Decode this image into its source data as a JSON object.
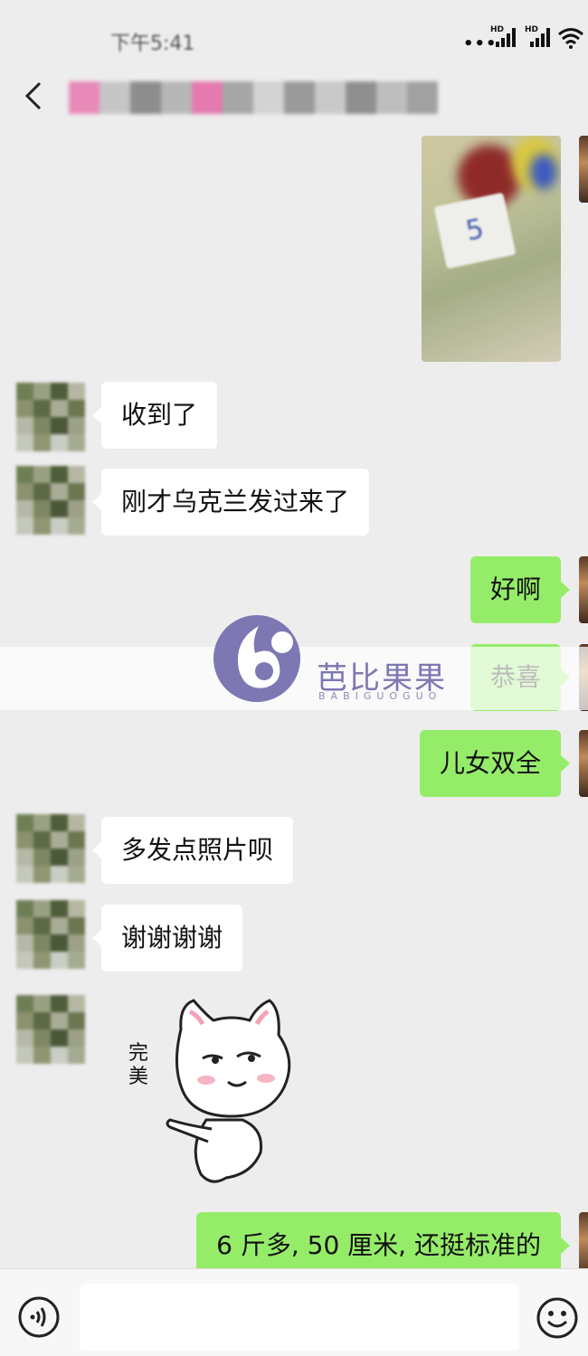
{
  "status_bar": {
    "time": "下午5:41",
    "signal_label_1": "HD",
    "signal_label_2": "HD",
    "dots": "•••"
  },
  "header": {
    "contact_name_redacted": true
  },
  "messages": [
    {
      "side": "in",
      "type": "text",
      "text": "收到了"
    },
    {
      "side": "in",
      "type": "text",
      "text": "刚才乌克兰发过来了"
    },
    {
      "side": "out",
      "type": "text",
      "text": "好啊"
    },
    {
      "side": "out",
      "type": "text",
      "text": "恭喜"
    },
    {
      "side": "out",
      "type": "text",
      "text": "儿女双全"
    },
    {
      "side": "in",
      "type": "text",
      "text": "多发点照片呗"
    },
    {
      "side": "in",
      "type": "text",
      "text": "谢谢谢谢"
    },
    {
      "side": "in",
      "type": "sticker",
      "text": "完美",
      "icon": "cat-pointing-sticker"
    },
    {
      "side": "out",
      "type": "text",
      "text": "6 斤多, 50 厘米, 还挺标准的"
    }
  ],
  "watermark": {
    "name": "芭比果果",
    "sub": "BABIGUOGUO",
    "color": "#7d77b4"
  },
  "input_bar": {
    "voice_icon": "voice-icon",
    "emoji_icon": "emoji-icon",
    "value": ""
  },
  "colors": {
    "background": "#ededed",
    "incoming_bubble": "#ffffff",
    "outgoing_bubble": "#95ec69"
  }
}
